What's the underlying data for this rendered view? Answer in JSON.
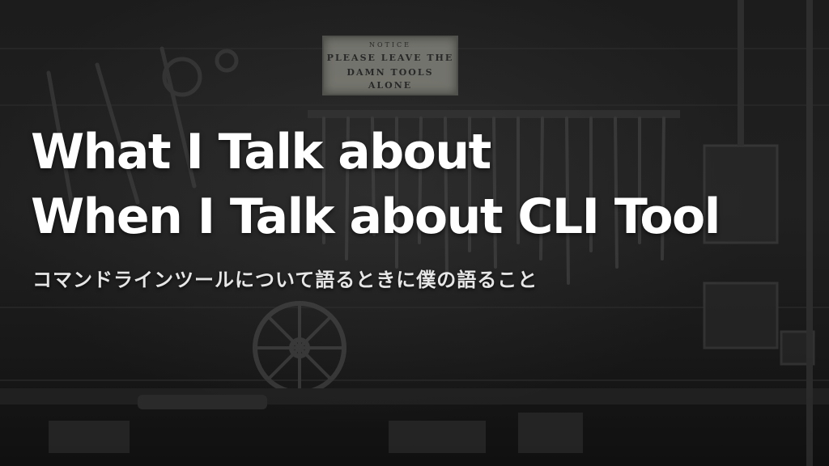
{
  "slide": {
    "title_line_1": "What I Talk about",
    "title_line_2": "When I Talk about CLI Tool",
    "subtitle": "コマンドラインツールについて語るときに僕の語ること"
  },
  "background": {
    "description_icon": "workshop-tools-wall",
    "notice_sign": {
      "line_1": "NOTICE",
      "line_2": "PLEASE LEAVE THE",
      "line_3": "DAMN TOOLS ALONE"
    },
    "colors": {
      "base": "#121212",
      "text": "#ffffff",
      "subtitle_text": "#e6e6e6"
    }
  }
}
